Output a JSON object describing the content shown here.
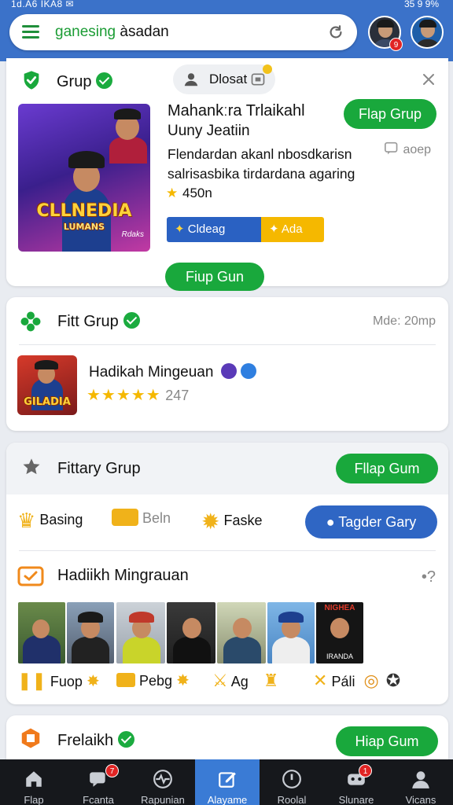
{
  "status": {
    "left": "1d.A6 IKA8 ✉",
    "right": "35 9 9%"
  },
  "search": {
    "prefix": "ganesing",
    "suffix": "àsadan"
  },
  "avatars": {
    "badge": "9"
  },
  "card1": {
    "title": "Grup",
    "chip": "Dlosat",
    "app_title": "Mahankːra Trlaikahl",
    "app_sub": "Uuny Jeatiin",
    "desc": "Flendardan akanl nbosdkarisn salrisasbika tirdardana agaring",
    "rating": "450n",
    "primary_button": "Flap Grup",
    "side_link": "aoep",
    "badge_blue": "Cldeag Miarl",
    "badge_yellow": "Ada",
    "footer_button": "Fiup Gun",
    "logo_text": "CLLNEDIA",
    "logo_sub": "LUMANS",
    "logo_tiny": "Rdaks"
  },
  "card2": {
    "title": "Fitt Grup",
    "meta": "Mde: 20mp",
    "item_name": "Hadikah Mingeuan",
    "stars": "★★★★★",
    "rating": "247",
    "logo_text": "GILADIA"
  },
  "card3": {
    "title": "Fittary Grup",
    "button": "Fllap Gum",
    "cats": [
      "Basing",
      "Beln",
      "Faske"
    ],
    "blue_button": "Tagder Gary",
    "section_title": "Hadiikh Mingrauan",
    "section_meta": "•?",
    "bottom_labels": [
      "Fuop",
      "Pebg",
      "Ag",
      "Páli"
    ],
    "photo_text_1": "NIGHEA",
    "photo_text_2": "IRANDA"
  },
  "card4": {
    "title": "Frelaikh",
    "button": "Hiap Gum"
  },
  "nav": [
    {
      "label": "Flap",
      "badge": ""
    },
    {
      "label": "Fcanta",
      "badge": "7"
    },
    {
      "label": "Rapunian",
      "badge": ""
    },
    {
      "label": "Alayame",
      "badge": ""
    },
    {
      "label": "Roolal",
      "badge": ""
    },
    {
      "label": "Slunare",
      "badge": "1"
    },
    {
      "label": "Vicans",
      "badge": ""
    }
  ],
  "colors": {
    "brand_blue": "#3b72c9",
    "green": "#19a83c",
    "nav_active": "#3a7bd5"
  }
}
